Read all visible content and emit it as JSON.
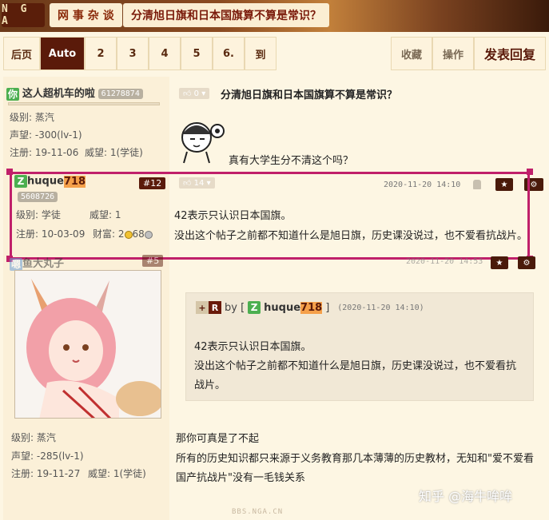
{
  "header": {
    "logo": "N G A",
    "forum": "网 事 杂 谈",
    "thread_title": "分清旭日旗和日本国旗算不算是常识？"
  },
  "pager": {
    "items": [
      "后页",
      "Auto",
      "2",
      "3",
      "4",
      "5",
      "6.",
      "到"
    ],
    "active": "Auto"
  },
  "actions": {
    "favorite": "收藏",
    "operate": "操作",
    "reply": "发表回复"
  },
  "post1": {
    "badge": "你",
    "username": "这人超机车的啦",
    "uid": "61278874",
    "level_label": "级别: 蒸汽",
    "reputation": "声望: -300(lv-1)",
    "register": "注册: 19-11-06",
    "prestige": "威望: 1(学徒)",
    "likes": "0",
    "title": "分清旭日旗和日本国旗算不算是常识？",
    "content": "真有大学生分不清这个吗？"
  },
  "post2": {
    "badge": "Z",
    "username_a": "huque",
    "username_b": "718",
    "uid": "5608726",
    "floor": "#12",
    "level_label": "级别: 学徒",
    "prestige": "威望: 1",
    "register": "注册: 10-03-09",
    "wealth": "财富: 2",
    "wealth_b": "68",
    "likes": "14",
    "time": "2020-11-20 14:10",
    "line1": "42表示只认识日本国旗。",
    "line2": "没出这个帖子之前都不知道什么是旭日旗，历史课没说过，也不爱看抗战片。"
  },
  "post3": {
    "badge": "嗯",
    "username": "鱼大丸子",
    "floor": "#5",
    "time": "2020-11-20 14:53",
    "level_label": "级别: 蒸汽",
    "reputation": "声望: -285(lv-1)",
    "register": "注册: 19-11-27",
    "prestige": "威望: 1(学徒)",
    "quote": {
      "plus": "+",
      "r": "R",
      "by": "by [",
      "badge": "Z",
      "user_a": "huque",
      "user_b": "718",
      "close": "]",
      "time": "(2020-11-20 14:10)",
      "line1": "42表示只认识日本国旗。",
      "line2": "没出这个帖子之前都不知道什么是旭日旗，历史课没说过，也不爱看抗",
      "line3": "战片。"
    },
    "reply1": "那你可真是了不起",
    "reply2": "所有的历史知识都只来源于义务教育那几本薄薄的历史教材，无知和\"爱不爱看",
    "reply3": "国产抗战片\"没有一毛钱关系"
  },
  "watermark": "知乎 @海牛哞哞",
  "footer_domain": "BBS.NGA.CN",
  "colors": {
    "accent": "#5a1a0a",
    "highlight": "#c0206a",
    "background": "#fdf6e3"
  }
}
